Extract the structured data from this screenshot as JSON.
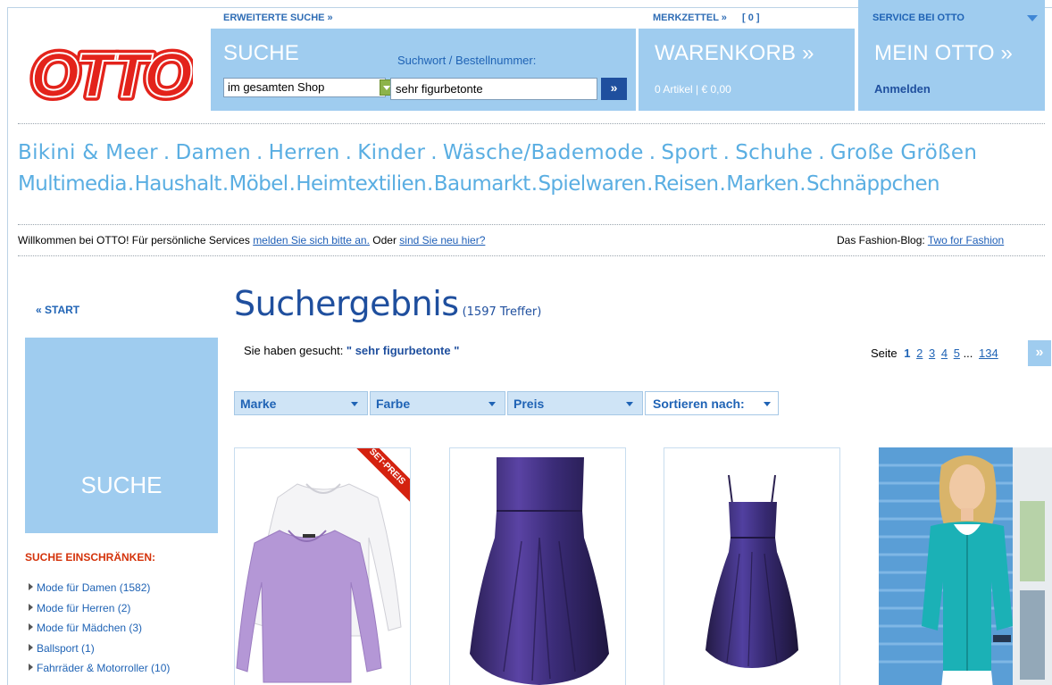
{
  "header": {
    "logo_text": "OTTO",
    "advanced_search": "ERWEITERTE SUCHE »",
    "merkzettel": "MERKZETTEL »",
    "merkzettel_count": "[ 0 ]",
    "service": "SERVICE BEI OTTO",
    "search": {
      "title": "SUCHE",
      "label": "Suchwort / Bestellnummer:",
      "scope_value": "im gesamten Shop",
      "query_value": "sehr figurbetonte",
      "go_label": "»"
    },
    "cart": {
      "title": "WARENKORB »",
      "info": "0 Artikel | € 0,00"
    },
    "account": {
      "title": "MEIN OTTO »",
      "login": "Anmelden"
    }
  },
  "nav": {
    "row1": [
      "Bikini & Meer",
      "Damen",
      "Herren",
      "Kinder",
      "Wäsche/Bademode",
      "Sport",
      "Schuhe",
      "Große Größen"
    ],
    "row2": [
      "Multimedia",
      "Haushalt",
      "Möbel",
      "Heimtextilien",
      "Baumarkt",
      "Spielwaren",
      "Reisen",
      "Marken",
      "Schnäppchen"
    ],
    "separator": "."
  },
  "welcome": {
    "text1": "Willkommen bei OTTO! Für persönliche Services ",
    "link1": "melden Sie sich bitte an.",
    "text2": " Oder ",
    "link2": "sind Sie neu hier?",
    "blog_label": "Das Fashion-Blog: ",
    "blog_link": "Two for Fashion"
  },
  "sidebar": {
    "start": "« START",
    "search_box": "SUCHE",
    "refine_heading": "SUCHE EINSCHRÄNKEN:",
    "items": [
      "Mode für Damen (1582)",
      "Mode für Herren (2)",
      "Mode für Mädchen (3)",
      "Ballsport (1)",
      "Fahrräder & Motorroller (10)"
    ]
  },
  "results": {
    "title": "Suchergebnis",
    "hits": "(1597 Treffer)",
    "searched_prefix": "Sie haben gesucht: ",
    "searched_term": "\" sehr figurbetonte \"",
    "pager": {
      "label": "Seite",
      "current": "1",
      "pages": [
        "2",
        "3",
        "4",
        "5"
      ],
      "ellipsis": "...",
      "last": "134",
      "next": "»"
    },
    "filters": {
      "brand": "Marke",
      "color": "Farbe",
      "price": "Preis",
      "sort": "Sortieren nach:"
    },
    "products": [
      {
        "image": "purple-and-white-long-sleeve-shirts",
        "badge": "SET-PREIS"
      },
      {
        "image": "purple-strapless-dress"
      },
      {
        "image": "purple-strappy-dress"
      },
      {
        "image": "woman-in-turquoise-cardigan"
      }
    ]
  },
  "colors": {
    "accent_blue": "#9fccef",
    "link_blue": "#1f63b5",
    "nav_blue": "#5aaee2",
    "logo_red": "#e3231b",
    "heading_red": "#d4330b"
  }
}
